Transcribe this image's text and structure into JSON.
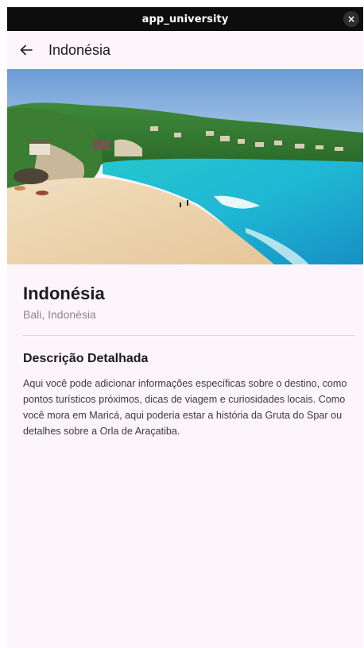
{
  "window": {
    "title": "app_university",
    "close_glyph": "×"
  },
  "appbar": {
    "back_icon": "arrow-left-icon",
    "title": "Indonésia"
  },
  "hero_image": {
    "subject": "tropical-beach-photo"
  },
  "details": {
    "title": "Indonésia",
    "subtitle": "Bali, Indonésia",
    "section_title": "Descrição Detalhada",
    "description": "Aqui você pode adicionar informações específicas sobre o destino, como pontos turísticos próximos, dicas de viagem e curiosidades locais. Como você mora em Maricá, aqui poderia estar a história da Gruta do Spar ou detalhes sobre a Orla de Araçatiba."
  },
  "colors": {
    "titlebar_bg": "#0d0d0d",
    "page_bg": "#fcf5fc",
    "text_primary": "#1c1b1f",
    "text_secondary": "#8a8590"
  }
}
